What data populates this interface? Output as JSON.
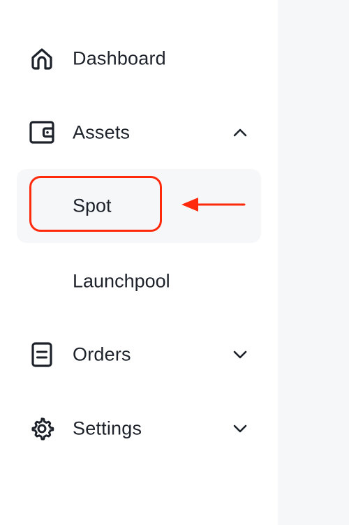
{
  "sidebar": {
    "items": [
      {
        "key": "dashboard",
        "label": "Dashboard",
        "icon": "home-icon",
        "expanded": null
      },
      {
        "key": "assets",
        "label": "Assets",
        "icon": "wallet-icon",
        "expanded": true,
        "children": [
          {
            "label": "Spot",
            "active": true
          },
          {
            "label": "Launchpool",
            "active": false
          }
        ]
      },
      {
        "key": "orders",
        "label": "Orders",
        "icon": "document-icon",
        "expanded": false
      },
      {
        "key": "settings",
        "label": "Settings",
        "icon": "gear-icon",
        "expanded": false
      }
    ]
  },
  "annotation": {
    "highlight_target": "Spot",
    "color": "#ff2a0c"
  },
  "colors": {
    "text": "#1d2129",
    "active_bg": "#f6f7f9",
    "content_bg": "#f6f7f9"
  }
}
